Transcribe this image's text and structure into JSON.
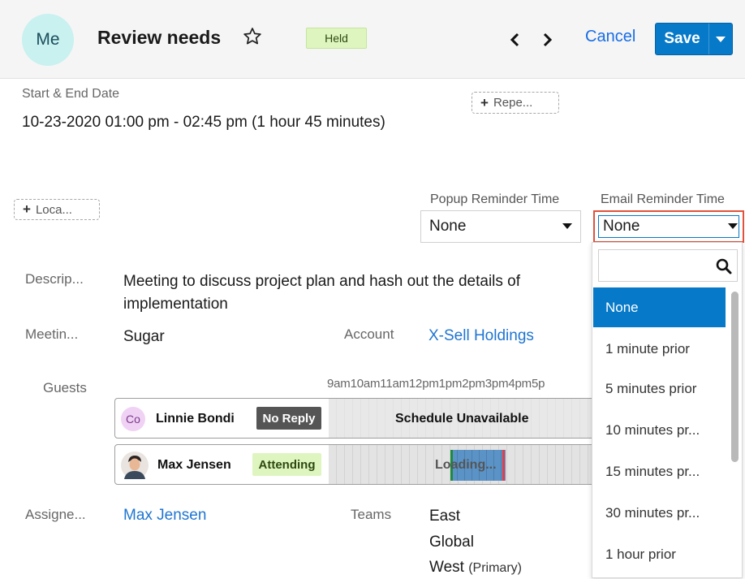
{
  "header": {
    "avatar": "Me",
    "title": "Review needs",
    "status": "Held",
    "cancel_label": "Cancel",
    "save_label": "Save"
  },
  "fields": {
    "start_end_label": "Start & End Date",
    "start_end_value": "10-23-2020 01:00 pm - 02:45 pm (1 hour 45 minutes)",
    "repeat_label": "Repe...",
    "location_label": "Loca...",
    "popup_label": "Popup Reminder Time",
    "popup_value": "None",
    "email_label": "Email Reminder Time",
    "email_value": "None",
    "description_label": "Descrip...",
    "description_value": "Meeting to discuss project plan and hash out the details of implementation",
    "meeting_label": "Meetin...",
    "meeting_value": "Sugar",
    "account_label": "Account",
    "account_value": "X-Sell Holdings",
    "guests_label": "Guests",
    "assigned_label": "Assigne...",
    "assigned_value": "Max Jensen",
    "teams_label": "Teams",
    "teams": [
      {
        "name": "East",
        "note": ""
      },
      {
        "name": "Global",
        "note": ""
      },
      {
        "name": "West",
        "note": "(Primary)"
      }
    ]
  },
  "schedule": {
    "time_header": "9am10am11am12pm1pm2pm3pm4pm5p",
    "guests": [
      {
        "initials": "Co",
        "name": "Linnie Bondi",
        "status": "No Reply",
        "schedule_text": "Schedule Unavailable"
      },
      {
        "initials": "",
        "name": "Max Jensen",
        "status": "Attending",
        "schedule_text": "Loading..."
      }
    ]
  },
  "email_dropdown": {
    "search_placeholder": "",
    "options": [
      "None",
      "1 minute prior",
      "5 minutes prior",
      "10 minutes pr...",
      "15 minutes pr...",
      "30 minutes pr...",
      "1 hour prior"
    ],
    "selected": "None"
  },
  "colors": {
    "accent": "#0679c8",
    "link": "#1f75d1",
    "highlight_border": "#e0523c",
    "attending_bg": "#dff5c0",
    "no_reply_bg": "#555555"
  },
  "icons": [
    "star-outline-icon",
    "chevron-left-icon",
    "chevron-right-icon",
    "caret-down-icon",
    "plus-icon",
    "search-icon",
    "user-photo-icon"
  ]
}
